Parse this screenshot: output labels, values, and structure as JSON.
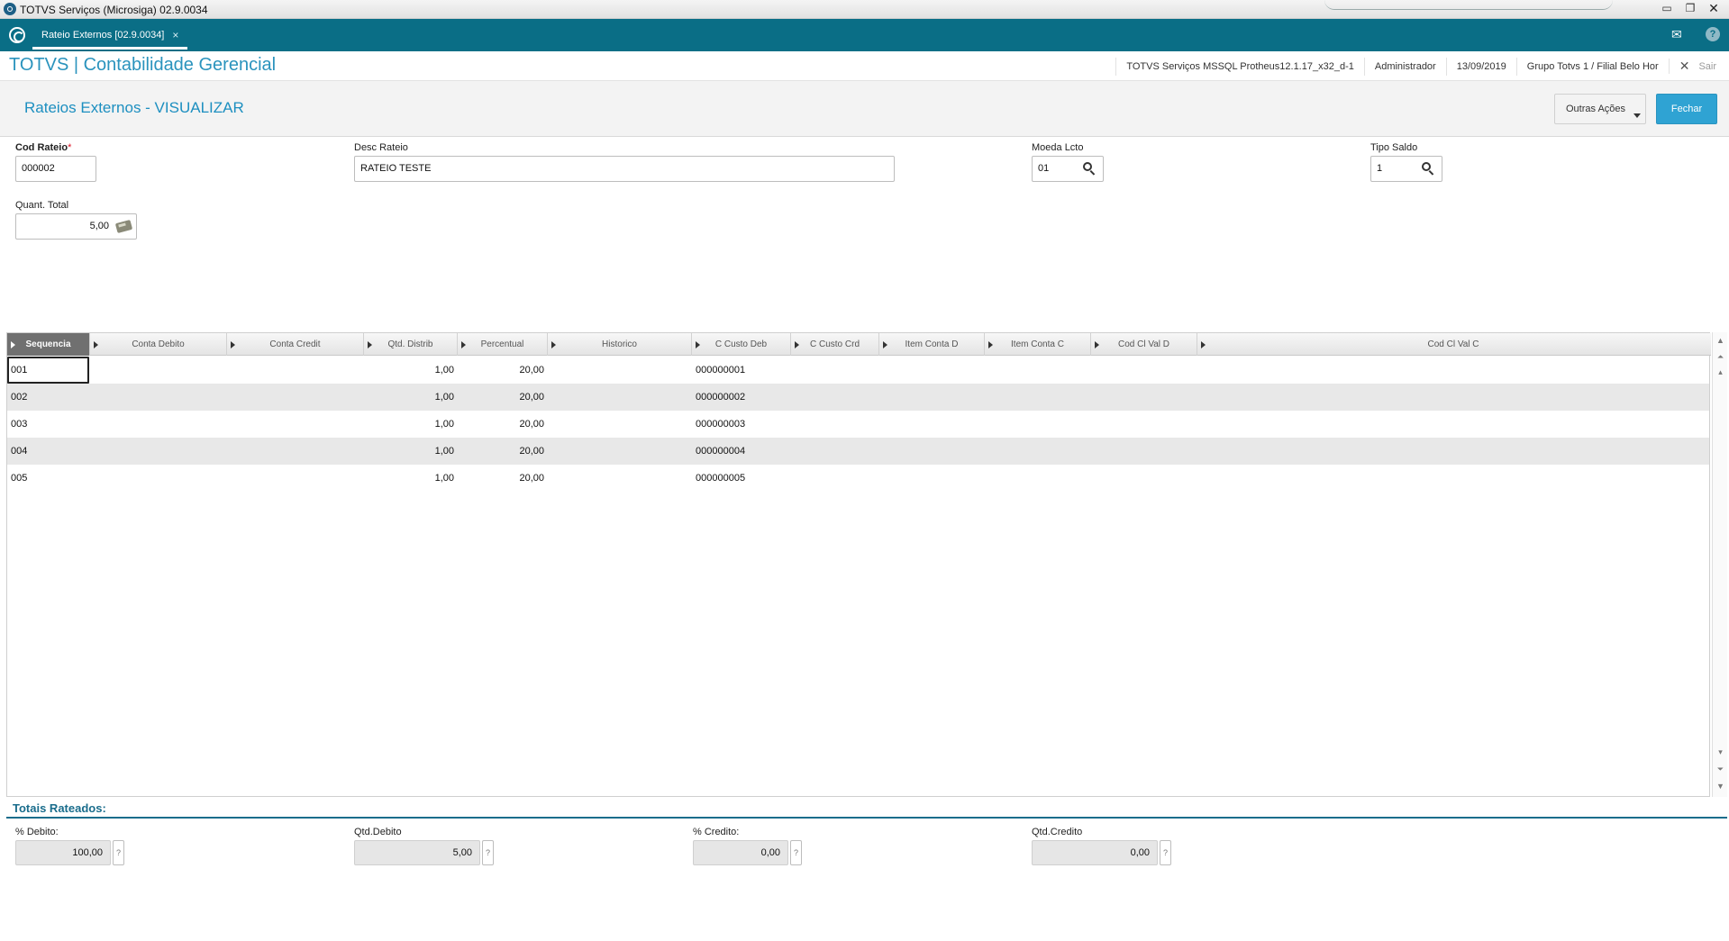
{
  "os": {
    "title": "TOTVS Serviços (Microsiga) 02.9.0034",
    "min": "▭",
    "max": "❐",
    "close": "✕"
  },
  "apptab": {
    "label": "Rateio Externos [02.9.0034]",
    "close": "×"
  },
  "module": {
    "title": "TOTVS | Contabilidade Gerencial",
    "info": {
      "env": "TOTVS Serviços MSSQL Protheus12.1.17_x32_d-1",
      "user": "Administrador",
      "date": "13/09/2019",
      "branch": "Grupo Totvs 1 / Filial Belo Hor",
      "exit": "Sair"
    }
  },
  "page": {
    "title": "Rateios Externos - VISUALIZAR",
    "outras_acoes": "Outras Ações",
    "fechar": "Fechar"
  },
  "form": {
    "cod_rateio": {
      "label": "Cod Rateio",
      "required": "*",
      "value": "000002"
    },
    "desc_rateio": {
      "label": "Desc Rateio",
      "value": "RATEIO TESTE"
    },
    "moeda_lcto": {
      "label": "Moeda Lcto",
      "value": "01"
    },
    "tipo_saldo": {
      "label": "Tipo Saldo",
      "value": "1"
    },
    "quant_total": {
      "label": "Quant. Total",
      "value": "5,00"
    }
  },
  "grid": {
    "columns": [
      "Sequencia",
      "Conta Debito",
      "Conta Credit",
      "Qtd. Distrib",
      "Percentual",
      "Historico",
      "C Custo Deb",
      "C Custo Crd",
      "Item Conta D",
      "Item Conta C",
      "Cod Cl Val D",
      "Cod Cl Val C"
    ],
    "rows": [
      {
        "seq": "001",
        "qtd": "1,00",
        "perc": "20,00",
        "ccdeb": "000000001"
      },
      {
        "seq": "002",
        "qtd": "1,00",
        "perc": "20,00",
        "ccdeb": "000000002"
      },
      {
        "seq": "003",
        "qtd": "1,00",
        "perc": "20,00",
        "ccdeb": "000000003"
      },
      {
        "seq": "004",
        "qtd": "1,00",
        "perc": "20,00",
        "ccdeb": "000000004"
      },
      {
        "seq": "005",
        "qtd": "1,00",
        "perc": "20,00",
        "ccdeb": "000000005"
      }
    ]
  },
  "totals": {
    "title": "Totais Rateados:",
    "perc_debito": {
      "label": "% Debito:",
      "value": "100,00"
    },
    "qtd_debito": {
      "label": "Qtd.Debito",
      "value": "5,00"
    },
    "perc_credito": {
      "label": "% Credito:",
      "value": "0,00"
    },
    "qtd_credito": {
      "label": "Qtd.Credito",
      "value": "0,00"
    },
    "help": "?"
  },
  "colors": {
    "brand": "#0a6e86",
    "accent": "#2fa3d3",
    "title": "#2a93bd"
  }
}
